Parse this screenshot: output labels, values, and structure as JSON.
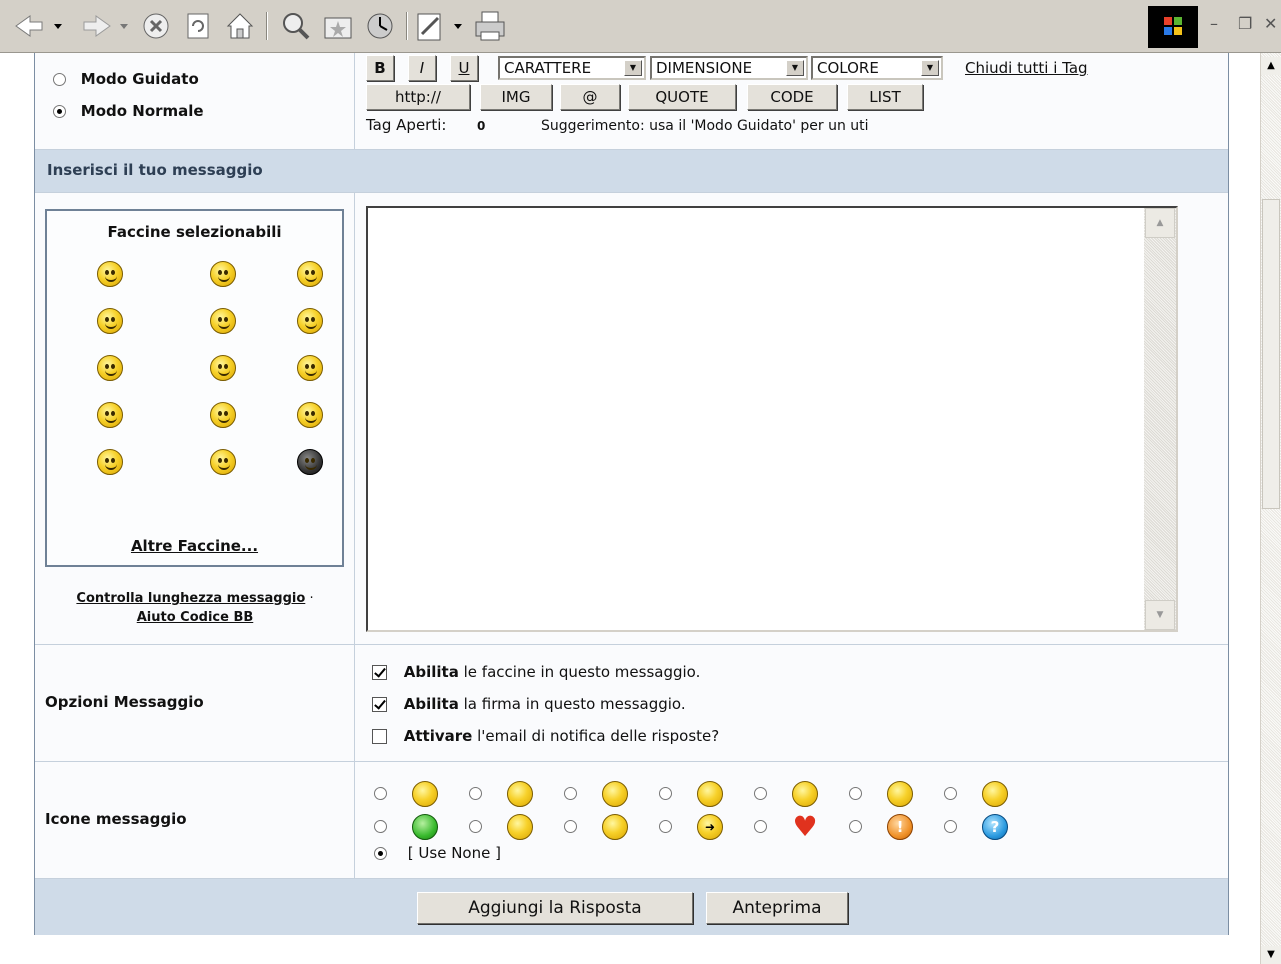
{
  "browser": {
    "toolbar_buttons": [
      "back-icon",
      "forward-icon",
      "stop-icon",
      "refresh-icon",
      "home-icon",
      "search-icon",
      "favorites-icon",
      "history-icon",
      "edit-icon",
      "print-icon"
    ],
    "window_controls": [
      "minimize",
      "restore",
      "close"
    ]
  },
  "mode": {
    "options": [
      {
        "label": "Modo Guidato",
        "selected": false
      },
      {
        "label": "Modo Normale",
        "selected": true
      }
    ]
  },
  "bbcode": {
    "bold": "B",
    "italic": "I",
    "underline": "U",
    "font_select": "CARATTERE",
    "size_select": "DIMENSIONE",
    "color_select": "COLORE",
    "close_tags_link": "Chiudi tutti i Tag",
    "buttons": [
      "http://",
      "IMG",
      "@",
      "QUOTE",
      "CODE",
      "LIST"
    ],
    "open_tags_label": "Tag Aperti:",
    "open_tags_count": "0",
    "hint": "Suggerimento: usa il 'Modo Guidato' per un uti"
  },
  "message_section_title": "Inserisci il tuo messaggio",
  "smilies": {
    "title": "Faccine selezionabili",
    "more_link": "Altre Faccine...",
    "count": 15
  },
  "links": {
    "check_length": "Controlla lunghezza messaggio",
    "separator": "·",
    "bb_help": "Aiuto Codice BB"
  },
  "message_body": "",
  "options": {
    "label": "Opzioni Messaggio",
    "items": [
      {
        "bold": "Abilita",
        "text": "le faccine in questo messaggio.",
        "checked": true
      },
      {
        "bold": "Abilita",
        "text": "la firma in questo messaggio.",
        "checked": true
      },
      {
        "bold": "Attivare",
        "text": "l'email di notifica delle risposte?",
        "checked": false
      }
    ]
  },
  "message_icons": {
    "label": "Icone messaggio",
    "row1": [
      "smile",
      "frown",
      "sleepy",
      "tongue",
      "surprised",
      "grin",
      "angry"
    ],
    "row2": [
      "sick",
      "eek",
      "cool",
      "arrow",
      "heart",
      "warning",
      "question"
    ],
    "orange_symbol": "!",
    "blue_symbol": "?",
    "none_label": "[ Use None ]",
    "none_selected": true
  },
  "actions": {
    "submit": "Aggiungi la Risposta",
    "preview": "Anteprima"
  },
  "colors": {
    "header_band": "#cfdbe8",
    "border": "#7c8ea3",
    "panel_bg": "#fafbfd"
  }
}
